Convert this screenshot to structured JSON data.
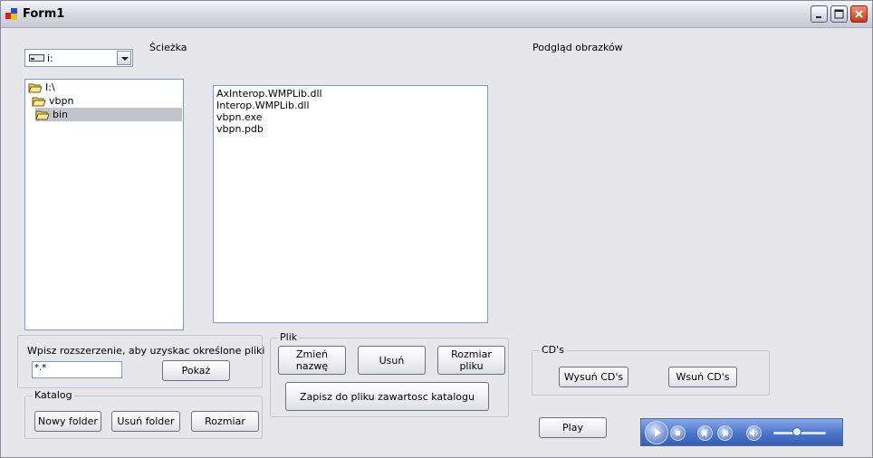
{
  "window": {
    "title": "Form1"
  },
  "path_label": "Ścieżka",
  "preview_label": "Podgląd obrazków",
  "drive_combo": {
    "value": "i:",
    "icon": "drive-icon"
  },
  "tree": [
    {
      "label": "I:\\",
      "icon": "folder-open-icon",
      "selected": false
    },
    {
      "label": "vbpn",
      "icon": "folder-open-icon",
      "selected": false
    },
    {
      "label": "bin",
      "icon": "folder-open-icon",
      "selected": true
    }
  ],
  "files": [
    "AxInterop.WMPLib.dll",
    "Interop.WMPLib.dll",
    "vbpn.exe",
    "vbpn.pdb"
  ],
  "extension": {
    "label": "Wpisz rozszerzenie, aby uzyskac określone pliki",
    "value": "*.*",
    "show_button": "Pokaż"
  },
  "katalog": {
    "title": "Katalog",
    "new_folder": "Nowy folder",
    "delete_folder": "Usuń folder",
    "size": "Rozmiar"
  },
  "plik": {
    "title": "Plik",
    "rename_line1": "Zmień",
    "rename_line2": "nazwę",
    "delete": "Usuń",
    "size_line1": "Rozmiar",
    "size_line2": "pliku",
    "save_contents": "Zapisz do pliku zawartosc katalogu"
  },
  "cds": {
    "title": "CD's",
    "eject": "Wysuń CD's",
    "insert": "Wsuń CD's"
  },
  "play_button": "Play",
  "media_player": {
    "volume": 0.45
  },
  "colors": {
    "selection": "#c3c3cc",
    "player": "#4a74c8"
  }
}
